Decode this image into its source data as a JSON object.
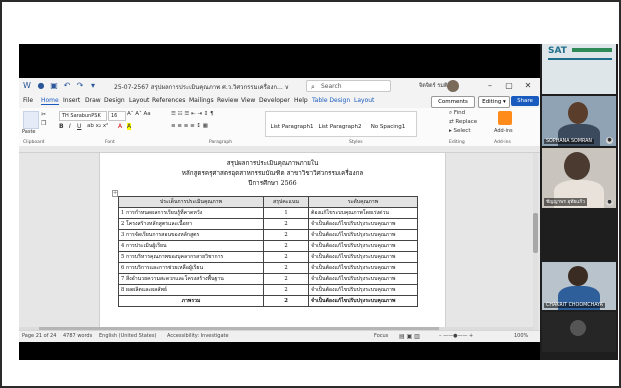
{
  "word": {
    "title_bar": {
      "document_name": "25-07-2567 สรุปผลการประเมินคุณภาพ ศ.ว.วิศวกรรมเครื่องก...  ∨",
      "search_placeholder": "Search",
      "user_name": "จิตจิตร์ รมติกา",
      "minimize": "–",
      "restore": "▢",
      "close": "✕"
    },
    "menu": [
      "File",
      "Home",
      "Insert",
      "Draw",
      "Design",
      "Layout",
      "References",
      "Mailings",
      "Review",
      "View",
      "Developer",
      "Help",
      "Table Design",
      "Layout"
    ],
    "menu_active": "Home",
    "comments_label": "Comments",
    "editing_label": "Editing",
    "share_label": "Share",
    "ribbon": {
      "paste_label": "Paste",
      "font_name": "TH SarabunPSK",
      "font_size": "16",
      "group_labels": [
        "Clipboard",
        "Font",
        "Paragraph",
        "Styles",
        "Editing",
        "Add-ins"
      ],
      "styles": [
        "List Paragraph1",
        "List Paragraph2",
        "No Spacing1"
      ],
      "editing_items": [
        "Find",
        "Replace",
        "Select"
      ],
      "addins_label": "Add-ins"
    },
    "document": {
      "title_lines": [
        "สรุปผลการประเมินคุณภาพภายใน",
        "หลักสูตรครุศาสตรอุตสาหกรรมบัณฑิต สาขาวิชาวิศวกรรมเครื่องกล",
        "ปีการศึกษา 2566"
      ],
      "table": {
        "headers": [
          "ประเด็นการประเมินคุณภาพ",
          "สรุปคะแนน",
          "ระดับคุณภาพ"
        ],
        "rows": [
          [
            "1 การกำหนดผลการเรียนรู้ที่คาดหวัง",
            "1",
            "ต้องแก้ไขระบบคุณภาพโดยเร่งด่วน"
          ],
          [
            "2 โครงสร้างหลักสูตรและเนื้อหา",
            "2",
            "จำเป็นต้องแก้ไขปรับปรุงระบบคุณภาพ"
          ],
          [
            "3 การจัดเรียนการสอนของหลักสูตร",
            "2",
            "จำเป็นต้องแก้ไขปรับปรุงระบบคุณภาพ"
          ],
          [
            "4 การประเมินผู้เรียน",
            "2",
            "จำเป็นต้องแก้ไขปรับปรุงระบบคุณภาพ"
          ],
          [
            "5 การบริหารคุณภาพของบุคลากรสายวิชาการ",
            "2",
            "จำเป็นต้องแก้ไขปรับปรุงระบบคุณภาพ"
          ],
          [
            "6 การบริการและการช่วยเหลือผู้เรียน",
            "2",
            "จำเป็นต้องแก้ไขปรับปรุงระบบคุณภาพ"
          ],
          [
            "7 สิ่งอำนวยความสะดวกและโครงสร้างพื้นฐาน",
            "2",
            "จำเป็นต้องแก้ไขปรับปรุงระบบคุณภาพ"
          ],
          [
            "8 ผลผลิตและผลลัพธ์",
            "2",
            "จำเป็นต้องแก้ไขปรับปรุงระบบคุณภาพ"
          ]
        ],
        "total_row": [
          "ภาพรวม",
          "2",
          "จำเป็นต้องแก้ไขปรับปรุงระบบคุณภาพ"
        ]
      }
    },
    "status_bar": {
      "page": "Page 21 of 24",
      "words": "4787 words",
      "language": "English (United States)",
      "accessibility": "Accessibility: Investigate",
      "focus": "Focus",
      "zoom": "100%"
    }
  },
  "participants": [
    {
      "name": "SAT",
      "kind": "logo"
    },
    {
      "name": "SOPHANA SOMRAN"
    },
    {
      "name": "ชัญญาพร อุทัยแก้ว"
    },
    {
      "name": "CHAKRIT CHOOMCHAYA"
    }
  ]
}
